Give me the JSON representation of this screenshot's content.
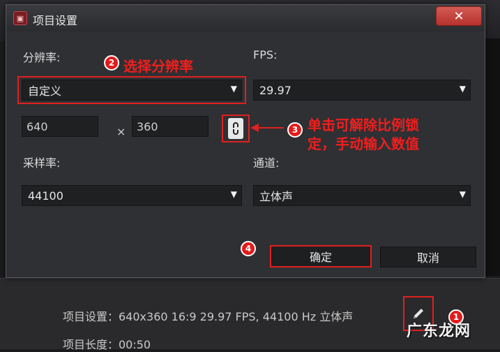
{
  "dialog": {
    "title": "项目设置",
    "close_label": "✕",
    "resolution_label": "分辨率:",
    "resolution_value": "自定义",
    "fps_label": "FPS:",
    "fps_value": "29.97",
    "width_value": "640",
    "times_symbol": "×",
    "height_value": "360",
    "samplerate_label": "采样率:",
    "samplerate_value": "44100",
    "channel_label": "通道:",
    "channel_value": "立体声",
    "ok_label": "确定",
    "cancel_label": "取消"
  },
  "annotations": {
    "step2_text": "选择分辨率",
    "step3_line1": "单击可解除比例锁",
    "step3_line2": "定，手动输入数值",
    "badge1": "1",
    "badge2": "2",
    "badge3": "3",
    "badge4": "4"
  },
  "status": {
    "project_settings": "项目设置：640x360 16:9 29.97 FPS, 44100 Hz 立体声",
    "project_length": "项目长度：00:50"
  },
  "watermark": "广东龙网",
  "colors": {
    "annotation_red": "#e02020",
    "dialog_bg": "#2f3033",
    "field_bg": "#1f2022"
  },
  "icons": [
    "app-icon",
    "close-icon",
    "dropdown-arrow-icon",
    "lock-icon",
    "pencil-icon",
    "arrow-left-icon"
  ]
}
